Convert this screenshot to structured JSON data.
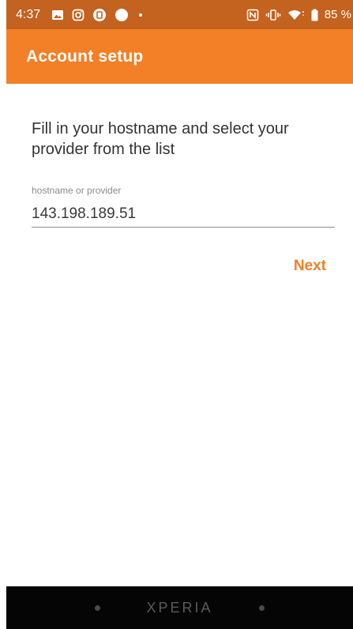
{
  "status_bar": {
    "time": "4:37",
    "battery_percent": "85 %",
    "icons_left": [
      "image-icon",
      "instagram-icon",
      "app-icon",
      "circle-icon",
      "dot-icon"
    ],
    "icons_right": [
      "nfc-icon",
      "vibrate-icon",
      "wifi-icon",
      "battery-icon"
    ]
  },
  "app_bar": {
    "title": "Account setup",
    "color": "#f37f26"
  },
  "main": {
    "instructions": "Fill in your hostname and select your provider from the list",
    "field": {
      "label": "hostname or provider",
      "value": "143.198.189.51"
    },
    "next_label": "Next"
  },
  "bezel": {
    "brand": "XPERIA"
  }
}
